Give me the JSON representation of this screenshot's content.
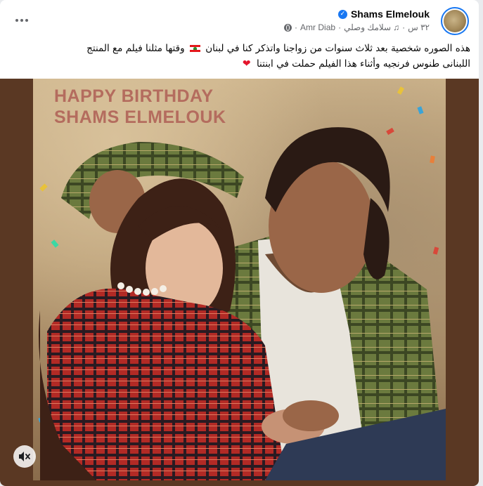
{
  "post": {
    "author_name": "Shams Elmelouk",
    "time": "٣٢ س",
    "audio_track": "سلامك وصلي",
    "audio_artist": "Amr Diab",
    "meta_sep": "·",
    "caption_line1a": "هذه الصوره شخصية  بعد ثلاث سنوات من زواجنا واتذكر كنا في لبنان",
    "caption_line1b": "وقتها مثلنا فيلم مع المنتج",
    "caption_line2": "اللبنانى طنوس فرنجيه   وأثناء هذا الفيلم حملت في ابنتنا"
  },
  "media": {
    "banner_line1": "HAPPY BIRTHDAY",
    "banner_line2": "SHAMS ELMELOUK"
  },
  "icons": {
    "more": "more-horizontal-icon",
    "verified": "verified-badge-icon",
    "globe": "public-globe-icon",
    "music": "music-note-icon",
    "flag": "lebanon-flag-icon",
    "heart": "red-heart-icon",
    "mute": "speaker-muted-icon"
  },
  "colors": {
    "accent": "#1877f2",
    "text_primary": "#050505",
    "text_secondary": "#65676b",
    "media_bg": "#5a3823",
    "banner_text": "#b46c5e"
  }
}
